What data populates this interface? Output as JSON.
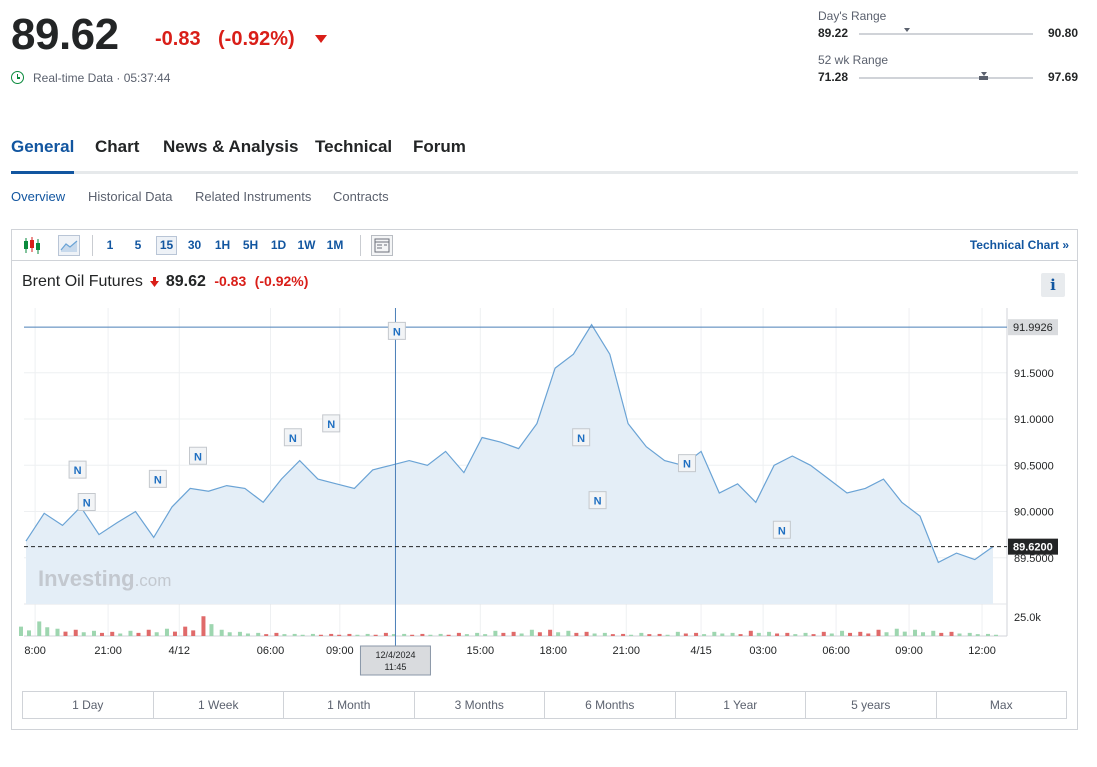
{
  "quote": {
    "price": "89.62",
    "change": "-0.83",
    "change_pct": "(-0.92%)",
    "realtime_label": "Real-time Data · 05:37:44",
    "accent_down": "#d91e18",
    "accent_up": "#0a8a3c"
  },
  "ranges": {
    "day": {
      "title": "Day's Range",
      "low": "89.22",
      "high": "90.80",
      "marker_fraction": 0.26
    },
    "wk52": {
      "title": "52 wk Range",
      "low": "71.28",
      "high": "97.69",
      "marker_fraction": 0.7,
      "fill_fraction_start": 0.69,
      "fill_fraction_end": 0.74
    }
  },
  "main_tabs": [
    "General",
    "Chart",
    "News & Analysis",
    "Technical",
    "Forum"
  ],
  "sub_tabs": [
    "Overview",
    "Historical Data",
    "Related Instruments",
    "Contracts"
  ],
  "toolbar": {
    "icons": [
      "candlestick-icon",
      "area-chart-icon",
      "layout-icon"
    ],
    "intervals": [
      "1",
      "5",
      "15",
      "30",
      "1H",
      "5H",
      "1D",
      "1W",
      "1M"
    ],
    "active_interval": "15",
    "technical_link": "Technical Chart »"
  },
  "instrument": {
    "name": "Brent Oil Futures",
    "price": "89.62",
    "change": "-0.83",
    "change_pct": "(-0.92%)",
    "info_label": "i"
  },
  "chart_data": {
    "type": "area",
    "series_color": "#6aa3d5",
    "fill_color": "#e4eef7",
    "y_ticks": [
      "91.5000",
      "91.0000",
      "90.5000",
      "90.0000",
      "89.5000"
    ],
    "y_tick_values": [
      91.5,
      91.0,
      90.5,
      90.0,
      89.5
    ],
    "ylim": [
      89.0,
      92.2
    ],
    "crosshair_value": "91.9926",
    "crosshair_y": 91.9926,
    "crosshair_x_index": 20.25,
    "crosshair_date": "12/4/2024",
    "crosshair_time": "11:45",
    "last_value": "89.6200",
    "last_y": 89.62,
    "x_ticks": [
      "8:00",
      "21:00",
      "4/12",
      "06:00",
      "09:00",
      "15:00",
      "18:00",
      "21:00",
      "4/15",
      "03:00",
      "06:00",
      "09:00",
      "12:00"
    ],
    "x_tick_indices": [
      0.5,
      4.5,
      8.4,
      13.4,
      17.2,
      24.9,
      28.9,
      32.9,
      37.0,
      40.4,
      44.4,
      48.4,
      52.4
    ],
    "x_count": 54,
    "values": [
      89.68,
      89.98,
      89.85,
      90.05,
      89.75,
      89.88,
      90.0,
      89.72,
      90.05,
      90.25,
      90.22,
      90.28,
      90.25,
      90.1,
      90.35,
      90.55,
      90.35,
      90.3,
      90.25,
      90.45,
      90.5,
      90.55,
      90.5,
      90.65,
      90.42,
      90.8,
      90.75,
      90.68,
      90.95,
      91.55,
      91.7,
      92.02,
      91.7,
      90.95,
      90.7,
      90.55,
      90.5,
      90.65,
      90.2,
      90.3,
      90.1,
      90.5,
      90.6,
      90.5,
      90.35,
      90.2,
      90.25,
      90.35,
      90.1,
      89.95,
      89.45,
      89.55,
      89.48,
      89.62
    ],
    "volume_ticks": [
      "25.0k"
    ],
    "volume_values": [
      9,
      14,
      7,
      6,
      5,
      4,
      5,
      6,
      7,
      9,
      19,
      6,
      4,
      3,
      3,
      2,
      2,
      2,
      2,
      2,
      3,
      2,
      2,
      2,
      3,
      3,
      5,
      4,
      6,
      6,
      5,
      4,
      3,
      2,
      3,
      2,
      4,
      3,
      4,
      3,
      5,
      4,
      3,
      3,
      4,
      5,
      4,
      6,
      7,
      6,
      5,
      4,
      3,
      2
    ],
    "volume_colors_up": [
      true,
      true,
      true,
      false,
      true,
      false,
      true,
      false,
      true,
      false,
      false,
      true,
      true,
      true,
      false,
      true,
      true,
      false,
      false,
      true,
      false,
      true,
      false,
      true,
      false,
      true,
      true,
      false,
      true,
      false,
      true,
      false,
      true,
      false,
      true,
      false,
      true,
      false,
      true,
      true,
      false,
      true,
      false,
      true,
      false,
      true,
      false,
      false,
      true,
      true,
      true,
      false,
      true,
      true
    ],
    "volume_ylim": [
      0,
      25
    ],
    "news_markers": [
      {
        "label": "N",
        "x_index": 2.8,
        "y": 90.35
      },
      {
        "label": "N",
        "x_index": 3.3,
        "y": 90.0
      },
      {
        "label": "N",
        "x_index": 7.2,
        "y": 90.25
      },
      {
        "label": "N",
        "x_index": 9.4,
        "y": 90.5
      },
      {
        "label": "N",
        "x_index": 14.6,
        "y": 90.7
      },
      {
        "label": "N",
        "x_index": 16.7,
        "y": 90.85
      },
      {
        "label": "N",
        "x_index": 20.3,
        "y": 91.85
      },
      {
        "label": "N",
        "x_index": 30.4,
        "y": 90.7
      },
      {
        "label": "N",
        "x_index": 31.3,
        "y": 90.02
      },
      {
        "label": "N",
        "x_index": 36.2,
        "y": 90.42
      },
      {
        "label": "N",
        "x_index": 41.4,
        "y": 89.7
      }
    ],
    "watermark": "Investing",
    "watermark_suffix": ".com",
    "grid": true,
    "legend": "none"
  },
  "periods": [
    "1 Day",
    "1 Week",
    "1 Month",
    "3 Months",
    "6 Months",
    "1 Year",
    "5 years",
    "Max"
  ]
}
